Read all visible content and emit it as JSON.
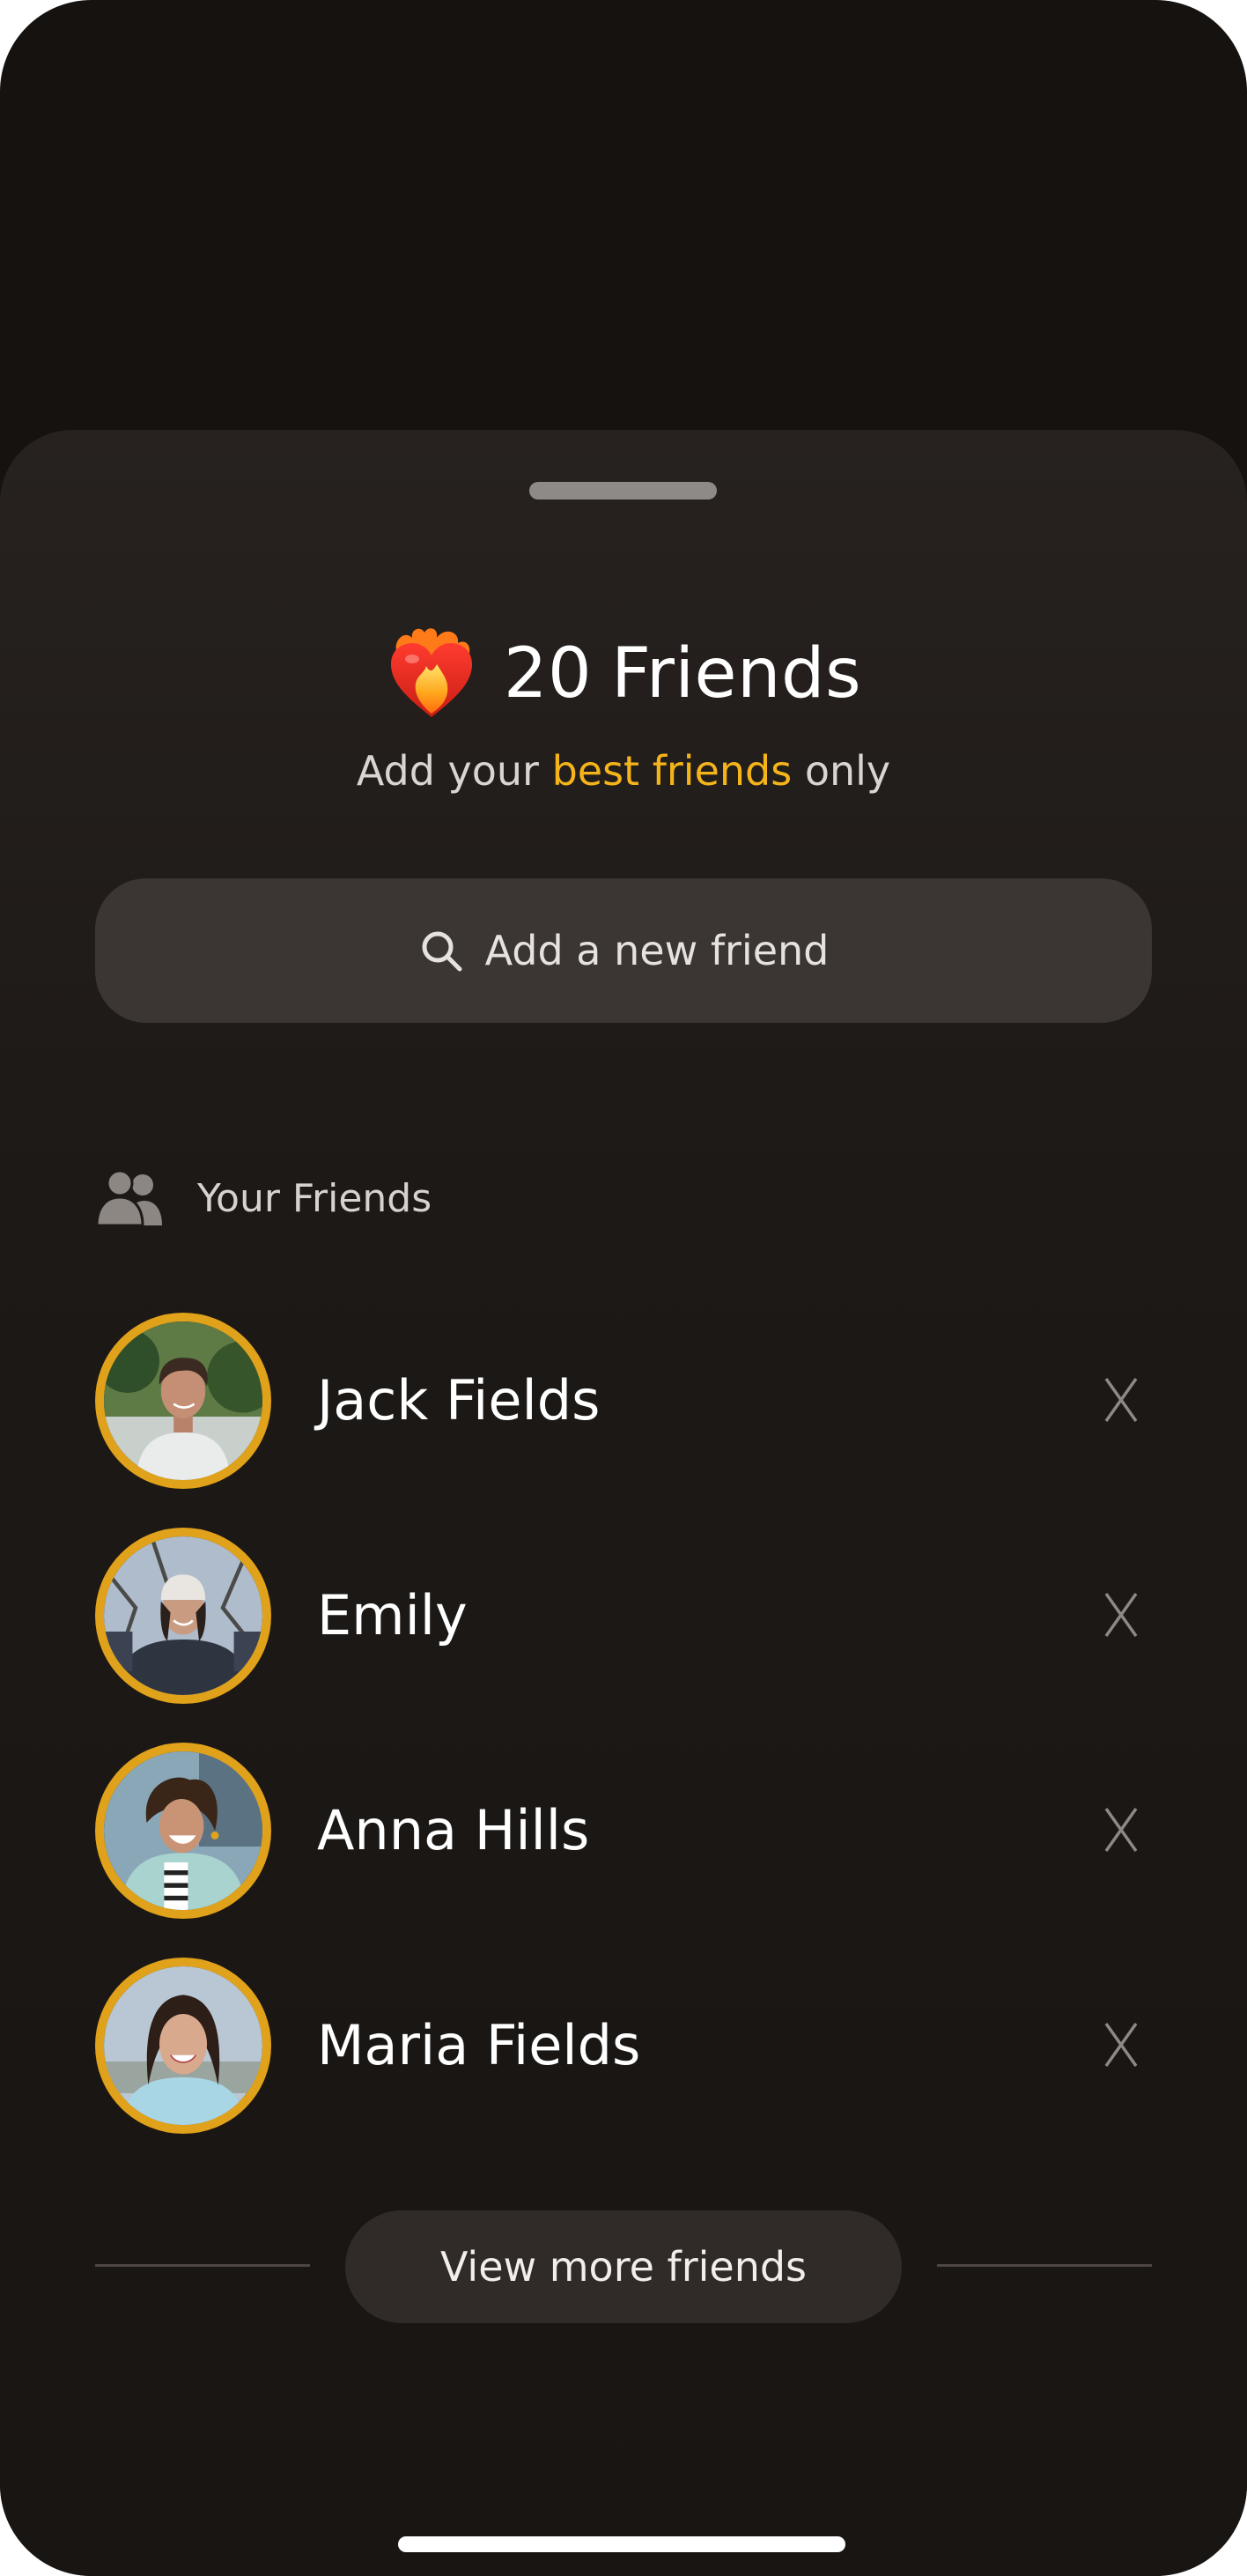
{
  "header": {
    "icon": "heart-on-fire-icon",
    "count": "20",
    "title": "Friends",
    "subtitle_prefix": "Add your ",
    "subtitle_accent": "best friends",
    "subtitle_suffix": " only"
  },
  "search": {
    "icon": "search-icon",
    "label": "Add a new friend"
  },
  "friends_section": {
    "icon": "people-icon",
    "label": "Your Friends",
    "items": [
      {
        "name": "Jack Fields",
        "avatar": "avatar-jack",
        "remove_icon": "close-icon"
      },
      {
        "name": "Emily",
        "avatar": "avatar-emily",
        "remove_icon": "close-icon"
      },
      {
        "name": "Anna Hills",
        "avatar": "avatar-anna",
        "remove_icon": "close-icon"
      },
      {
        "name": "Maria Fields",
        "avatar": "avatar-maria",
        "remove_icon": "close-icon"
      }
    ]
  },
  "footer": {
    "view_more_label": "View more friends"
  },
  "colors": {
    "accent": "#f5b41a",
    "avatar_ring": "#e0a11b",
    "background": "#151210",
    "sheet": "#1d1916",
    "search_field": "#3b3533"
  }
}
